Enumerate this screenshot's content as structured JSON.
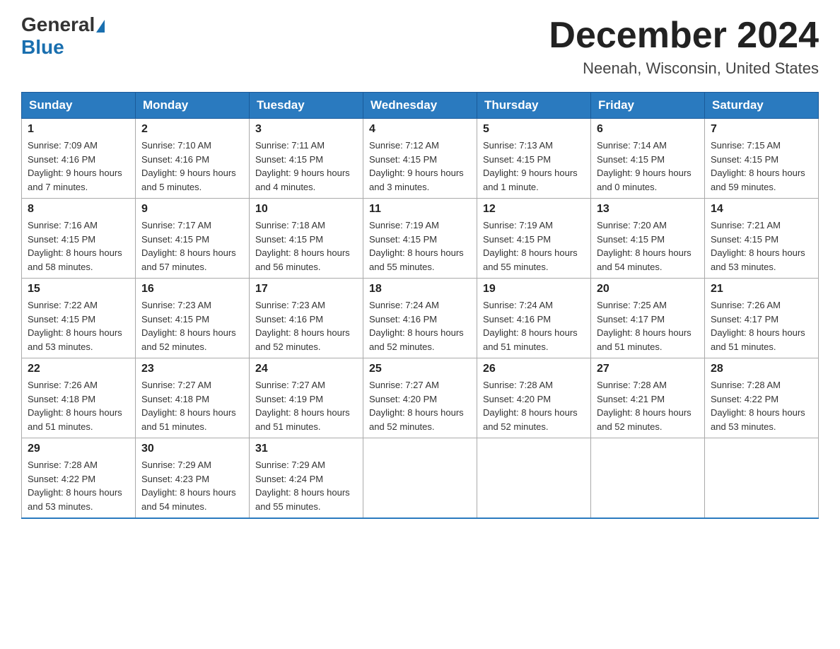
{
  "header": {
    "logo_line1": "General",
    "logo_line2": "Blue",
    "month_title": "December 2024",
    "location": "Neenah, Wisconsin, United States"
  },
  "days_of_week": [
    "Sunday",
    "Monday",
    "Tuesday",
    "Wednesday",
    "Thursday",
    "Friday",
    "Saturday"
  ],
  "weeks": [
    [
      {
        "day": "1",
        "sunrise": "7:09 AM",
        "sunset": "4:16 PM",
        "daylight": "9 hours and 7 minutes."
      },
      {
        "day": "2",
        "sunrise": "7:10 AM",
        "sunset": "4:16 PM",
        "daylight": "9 hours and 5 minutes."
      },
      {
        "day": "3",
        "sunrise": "7:11 AM",
        "sunset": "4:15 PM",
        "daylight": "9 hours and 4 minutes."
      },
      {
        "day": "4",
        "sunrise": "7:12 AM",
        "sunset": "4:15 PM",
        "daylight": "9 hours and 3 minutes."
      },
      {
        "day": "5",
        "sunrise": "7:13 AM",
        "sunset": "4:15 PM",
        "daylight": "9 hours and 1 minute."
      },
      {
        "day": "6",
        "sunrise": "7:14 AM",
        "sunset": "4:15 PM",
        "daylight": "9 hours and 0 minutes."
      },
      {
        "day": "7",
        "sunrise": "7:15 AM",
        "sunset": "4:15 PM",
        "daylight": "8 hours and 59 minutes."
      }
    ],
    [
      {
        "day": "8",
        "sunrise": "7:16 AM",
        "sunset": "4:15 PM",
        "daylight": "8 hours and 58 minutes."
      },
      {
        "day": "9",
        "sunrise": "7:17 AM",
        "sunset": "4:15 PM",
        "daylight": "8 hours and 57 minutes."
      },
      {
        "day": "10",
        "sunrise": "7:18 AM",
        "sunset": "4:15 PM",
        "daylight": "8 hours and 56 minutes."
      },
      {
        "day": "11",
        "sunrise": "7:19 AM",
        "sunset": "4:15 PM",
        "daylight": "8 hours and 55 minutes."
      },
      {
        "day": "12",
        "sunrise": "7:19 AM",
        "sunset": "4:15 PM",
        "daylight": "8 hours and 55 minutes."
      },
      {
        "day": "13",
        "sunrise": "7:20 AM",
        "sunset": "4:15 PM",
        "daylight": "8 hours and 54 minutes."
      },
      {
        "day": "14",
        "sunrise": "7:21 AM",
        "sunset": "4:15 PM",
        "daylight": "8 hours and 53 minutes."
      }
    ],
    [
      {
        "day": "15",
        "sunrise": "7:22 AM",
        "sunset": "4:15 PM",
        "daylight": "8 hours and 53 minutes."
      },
      {
        "day": "16",
        "sunrise": "7:23 AM",
        "sunset": "4:15 PM",
        "daylight": "8 hours and 52 minutes."
      },
      {
        "day": "17",
        "sunrise": "7:23 AM",
        "sunset": "4:16 PM",
        "daylight": "8 hours and 52 minutes."
      },
      {
        "day": "18",
        "sunrise": "7:24 AM",
        "sunset": "4:16 PM",
        "daylight": "8 hours and 52 minutes."
      },
      {
        "day": "19",
        "sunrise": "7:24 AM",
        "sunset": "4:16 PM",
        "daylight": "8 hours and 51 minutes."
      },
      {
        "day": "20",
        "sunrise": "7:25 AM",
        "sunset": "4:17 PM",
        "daylight": "8 hours and 51 minutes."
      },
      {
        "day": "21",
        "sunrise": "7:26 AM",
        "sunset": "4:17 PM",
        "daylight": "8 hours and 51 minutes."
      }
    ],
    [
      {
        "day": "22",
        "sunrise": "7:26 AM",
        "sunset": "4:18 PM",
        "daylight": "8 hours and 51 minutes."
      },
      {
        "day": "23",
        "sunrise": "7:27 AM",
        "sunset": "4:18 PM",
        "daylight": "8 hours and 51 minutes."
      },
      {
        "day": "24",
        "sunrise": "7:27 AM",
        "sunset": "4:19 PM",
        "daylight": "8 hours and 51 minutes."
      },
      {
        "day": "25",
        "sunrise": "7:27 AM",
        "sunset": "4:20 PM",
        "daylight": "8 hours and 52 minutes."
      },
      {
        "day": "26",
        "sunrise": "7:28 AM",
        "sunset": "4:20 PM",
        "daylight": "8 hours and 52 minutes."
      },
      {
        "day": "27",
        "sunrise": "7:28 AM",
        "sunset": "4:21 PM",
        "daylight": "8 hours and 52 minutes."
      },
      {
        "day": "28",
        "sunrise": "7:28 AM",
        "sunset": "4:22 PM",
        "daylight": "8 hours and 53 minutes."
      }
    ],
    [
      {
        "day": "29",
        "sunrise": "7:28 AM",
        "sunset": "4:22 PM",
        "daylight": "8 hours and 53 minutes."
      },
      {
        "day": "30",
        "sunrise": "7:29 AM",
        "sunset": "4:23 PM",
        "daylight": "8 hours and 54 minutes."
      },
      {
        "day": "31",
        "sunrise": "7:29 AM",
        "sunset": "4:24 PM",
        "daylight": "8 hours and 55 minutes."
      },
      null,
      null,
      null,
      null
    ]
  ],
  "labels": {
    "sunrise": "Sunrise:",
    "sunset": "Sunset:",
    "daylight": "Daylight:"
  }
}
